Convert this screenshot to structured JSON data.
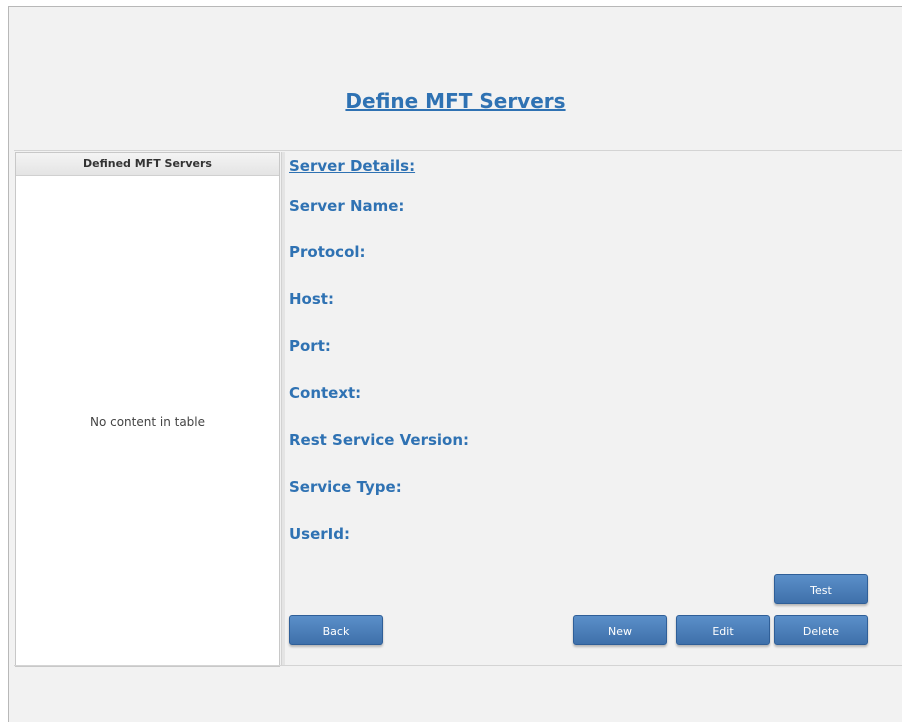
{
  "page": {
    "title": "Define MFT Servers"
  },
  "servers_table": {
    "header": "Defined MFT Servers",
    "empty_message": "No content in table"
  },
  "details": {
    "section_title": "Server Details:",
    "labels": {
      "server_name": "Server Name:",
      "protocol": "Protocol:",
      "host": "Host:",
      "port": "Port:",
      "context": "Context:",
      "rest_service_version": "Rest Service Version:",
      "service_type": "Service Type:",
      "userid": "UserId:"
    }
  },
  "buttons": {
    "test": "Test",
    "back": "Back",
    "new": "New",
    "edit": "Edit",
    "delete": "Delete"
  },
  "colors": {
    "accent_text": "#2f72b3",
    "button": "#4a7fbd"
  }
}
